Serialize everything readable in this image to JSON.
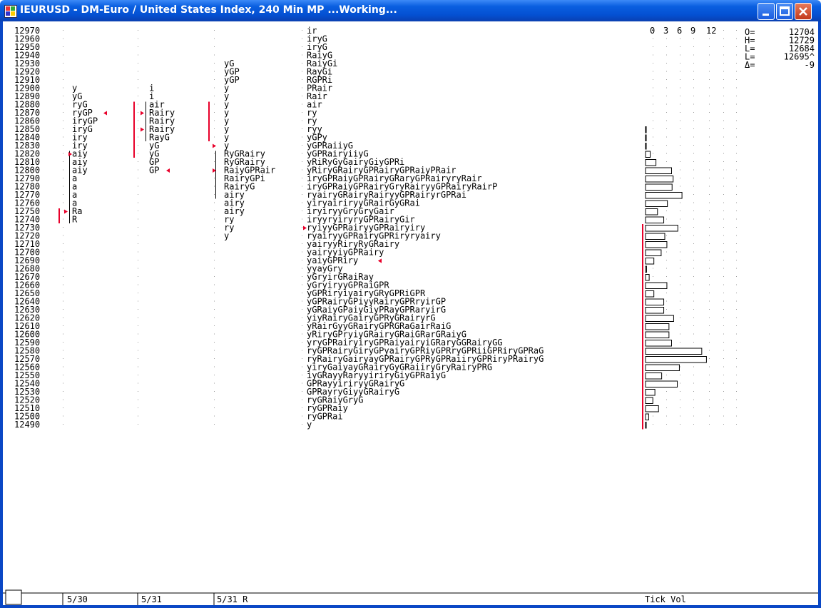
{
  "window": {
    "title": "IEURUSD - DM-Euro / United States Index, 240 Min MP ...Working...",
    "controls": [
      "minimize",
      "maximize",
      "close"
    ]
  },
  "price_rows": [
    {
      "price": "12970",
      "p1": "",
      "p2": "",
      "p3": "",
      "p4": "ir"
    },
    {
      "price": "12960",
      "p1": "",
      "p2": "",
      "p3": "",
      "p4": "iryG"
    },
    {
      "price": "12950",
      "p1": "",
      "p2": "",
      "p3": "",
      "p4": "iryG"
    },
    {
      "price": "12940",
      "p1": "",
      "p2": "",
      "p3": "",
      "p4": "RaiyG"
    },
    {
      "price": "12930",
      "p1": "",
      "p2": "",
      "p3": "yG",
      "p4": "RaiyGi"
    },
    {
      "price": "12920",
      "p1": "",
      "p2": "",
      "p3": "yGP",
      "p4": "RayGi"
    },
    {
      "price": "12910",
      "p1": "",
      "p2": "",
      "p3": "yGP",
      "p4": "RGPRi"
    },
    {
      "price": "12900",
      "p1": "y",
      "p2": "i",
      "p3": "y",
      "p4": "PRair"
    },
    {
      "price": "12890",
      "p1": "yG",
      "p2": "i",
      "p3": "y",
      "p4": "Rair"
    },
    {
      "price": "12880",
      "p1": "ryG",
      "p2": "air",
      "p3": "y",
      "p4": "air"
    },
    {
      "price": "12870",
      "p1": "ryGP",
      "p2": "Rairy",
      "p3": "y",
      "p4": "ry"
    },
    {
      "price": "12860",
      "p1": "iryGP",
      "p2": "Rairy",
      "p3": "y",
      "p4": "ry"
    },
    {
      "price": "12850",
      "p1": "iryG",
      "p2": "Rairy",
      "p3": "y",
      "p4": "ryy"
    },
    {
      "price": "12840",
      "p1": "iry",
      "p2": "RayG",
      "p3": "y",
      "p4": "yGPy"
    },
    {
      "price": "12830",
      "p1": "iry",
      "p2": "yG",
      "p3": "y",
      "p4": "yGPRaiiyG"
    },
    {
      "price": "12820",
      "p1": "aiy",
      "p2": "yG",
      "p3": "RyGRairy",
      "p4": "yGPRairyiiyG"
    },
    {
      "price": "12810",
      "p1": "aiy",
      "p2": "GP",
      "p3": "RyGRairy",
      "p4": "yRiRyGyGairyGiyGPRi"
    },
    {
      "price": "12800",
      "p1": "aiy",
      "p2": "GP",
      "p3": "RaiyGPRair",
      "p4": "yRiryGRairyGPRairyGPRaiyPRair"
    },
    {
      "price": "12790",
      "p1": "a",
      "p2": "",
      "p3": "RairyGPi",
      "p4": "iryGPRaiyGPRairyGRaryGPRairyryRair"
    },
    {
      "price": "12780",
      "p1": "a",
      "p2": "",
      "p3": "RairyG",
      "p4": "iryGPRaiyGPRairyGryRairyyGPRairyRairP"
    },
    {
      "price": "12770",
      "p1": "a",
      "p2": "",
      "p3": "airy",
      "p4": "ryairyGRairyRairyyGPRairyrGPRai"
    },
    {
      "price": "12760",
      "p1": "a",
      "p2": "",
      "p3": "airy",
      "p4": "yiryairiryyGRairGyGRai"
    },
    {
      "price": "12750",
      "p1": "Ra",
      "p2": "",
      "p3": "airy",
      "p4": "iryiryyGryGryGair"
    },
    {
      "price": "12740",
      "p1": "R",
      "p2": "",
      "p3": "ry",
      "p4": "iryyryiryryGPRairyGir"
    },
    {
      "price": "12730",
      "p1": "",
      "p2": "",
      "p3": "ry",
      "p4": "ryiyyGPRairyyGPRairyiry"
    },
    {
      "price": "12720",
      "p1": "",
      "p2": "",
      "p3": "y",
      "p4": "ryairyyGPRairyGPRiryryairy"
    },
    {
      "price": "12710",
      "p1": "",
      "p2": "",
      "p3": "",
      "p4": "yairyyRiryRyGRairy"
    },
    {
      "price": "12700",
      "p1": "",
      "p2": "",
      "p3": "",
      "p4": "yairyyiyGPRairy"
    },
    {
      "price": "12690",
      "p1": "",
      "p2": "",
      "p3": "",
      "p4": "yaiyGPRiry"
    },
    {
      "price": "12680",
      "p1": "",
      "p2": "",
      "p3": "",
      "p4": "yyayGry"
    },
    {
      "price": "12670",
      "p1": "",
      "p2": "",
      "p3": "",
      "p4": "yGryirGRaiRay"
    },
    {
      "price": "12660",
      "p1": "",
      "p2": "",
      "p3": "",
      "p4": "yGryiryyGPRaiGPR"
    },
    {
      "price": "12650",
      "p1": "",
      "p2": "",
      "p3": "",
      "p4": "yGPRiryiyairyGRyGPRiGPR"
    },
    {
      "price": "12640",
      "p1": "",
      "p2": "",
      "p3": "",
      "p4": "yGPRairyGPiyyRairyGPRryirGP"
    },
    {
      "price": "12630",
      "p1": "",
      "p2": "",
      "p3": "",
      "p4": "yGRaiyGPaiyGiyPRayGPRaryirG"
    },
    {
      "price": "12620",
      "p1": "",
      "p2": "",
      "p3": "",
      "p4": "yiyRairyGairyGPRyGRairyrG"
    },
    {
      "price": "12610",
      "p1": "",
      "p2": "",
      "p3": "",
      "p4": "yRairGyyGRairyGPRGRaGairRaiG"
    },
    {
      "price": "12600",
      "p1": "",
      "p2": "",
      "p3": "",
      "p4": "yRiryGPryiyGRairyGRaiGRarGRaiyG"
    },
    {
      "price": "12590",
      "p1": "",
      "p2": "",
      "p3": "",
      "p4": "yryGPRairyiryGPRaiyairyiGRaryGGRairyGG"
    },
    {
      "price": "12580",
      "p1": "",
      "p2": "",
      "p3": "",
      "p4": "ryGPRairyGiryGPyairyGPRiyGPRryGPRiiGPRiryGPRaG"
    },
    {
      "price": "12570",
      "p1": "",
      "p2": "",
      "p3": "",
      "p4": "ryRairyGairyayGPRairyGPRyGPRaiiryGPRiryPRairyG"
    },
    {
      "price": "12560",
      "p1": "",
      "p2": "",
      "p3": "",
      "p4": "yiryGaiyayGRairyGyGRaiiryGryRairyPRG"
    },
    {
      "price": "12550",
      "p1": "",
      "p2": "",
      "p3": "",
      "p4": "iyGRayyRaryyiriryGiyGPRaiyG"
    },
    {
      "price": "12540",
      "p1": "",
      "p2": "",
      "p3": "",
      "p4": "GPRayyiriryyGRairyG"
    },
    {
      "price": "12530",
      "p1": "",
      "p2": "",
      "p3": "",
      "p4": "GPRayryGiyyGRairyG"
    },
    {
      "price": "12520",
      "p1": "",
      "p2": "",
      "p3": "",
      "p4": "ryGRaiyGryG"
    },
    {
      "price": "12510",
      "p1": "",
      "p2": "",
      "p3": "",
      "p4": "ryGPRaiy"
    },
    {
      "price": "12500",
      "p1": "",
      "p2": "",
      "p3": "",
      "p4": "ryGPRai"
    },
    {
      "price": "12490",
      "p1": "",
      "p2": "",
      "p3": "",
      "p4": "y"
    }
  ],
  "date_labels": [
    "5/30",
    "5/31",
    "5/31 R"
  ],
  "tick_vol": {
    "label": "Tick Vol",
    "scale_labels": [
      "0",
      "3",
      "6",
      "9",
      "12"
    ],
    "bars": {
      "12850": 0.1,
      "12840": 0.1,
      "12830": 0.1,
      "12820": 0.9,
      "12810": 2.0,
      "12800": 5.0,
      "12790": 5.3,
      "12780": 5.1,
      "12770": 7.0,
      "12760": 4.2,
      "12750": 2.3,
      "12740": 3.5,
      "12730": 6.2,
      "12720": 3.7,
      "12710": 4.1,
      "12700": 3.0,
      "12690": 1.6,
      "12680": 0.2,
      "12670": 0.7,
      "12660": 4.1,
      "12650": 1.6,
      "12640": 3.5,
      "12630": 3.5,
      "12620": 5.4,
      "12610": 4.5,
      "12600": 4.5,
      "12590": 5.0,
      "12580": 10.8,
      "12570": 11.7,
      "12560": 6.5,
      "12550": 3.1,
      "12540": 6.1,
      "12530": 1.8,
      "12520": 1.4,
      "12510": 2.5,
      "12500": 0.6,
      "12490": 0.1
    }
  },
  "stats": [
    {
      "label": "O=",
      "value": "12704"
    },
    {
      "label": "H=",
      "value": "12729"
    },
    {
      "label": "L=",
      "value": "12684"
    },
    {
      "label": "L=",
      "value": "12695^"
    },
    {
      "label": "Δ=",
      "value": "-9"
    }
  ],
  "colors": {
    "titlebar": "#0a5fe0",
    "accent_red": "#e8002a",
    "text": "#000000",
    "background": "#ffffff",
    "dots": "#9a9a9a"
  }
}
